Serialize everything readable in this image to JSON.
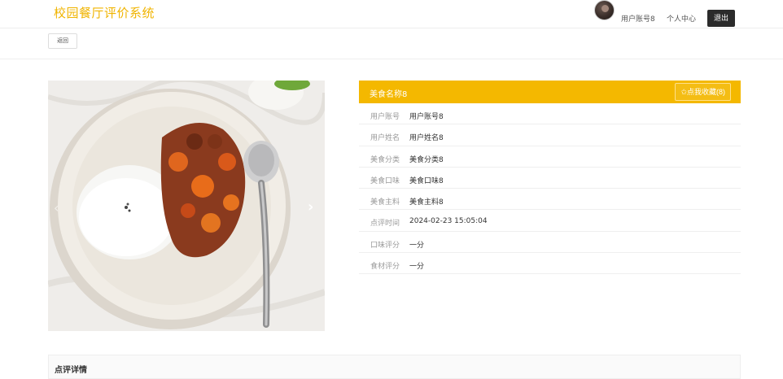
{
  "header": {
    "site_title": "校园餐厅评价系统",
    "user_account": "用户账号8",
    "personal_center": "个人中心",
    "logout": "退出"
  },
  "toolbar": {
    "back": "返回"
  },
  "carousel": {
    "prev_icon": "chevron-left-icon",
    "next_icon": "chevron-right-icon"
  },
  "detail": {
    "food_name": "美食名称8",
    "favorite_label": "✩点我收藏(8)",
    "rows": [
      {
        "label": "用户账号",
        "value": "用户账号8"
      },
      {
        "label": "用户姓名",
        "value": "用户姓名8"
      },
      {
        "label": "美食分类",
        "value": "美食分类8"
      },
      {
        "label": "美食口味",
        "value": "美食口味8"
      },
      {
        "label": "美食主料",
        "value": "美食主料8"
      },
      {
        "label": "点评时间",
        "value": "2024-02-23 15:05:04"
      },
      {
        "label": "口味评分",
        "value": "一分"
      },
      {
        "label": "食材评分",
        "value": "一分"
      }
    ]
  },
  "review": {
    "title": "点评详情"
  },
  "colors": {
    "accent": "#f4b800",
    "title": "#f0b400",
    "logout_bg": "#2b2b2b"
  }
}
